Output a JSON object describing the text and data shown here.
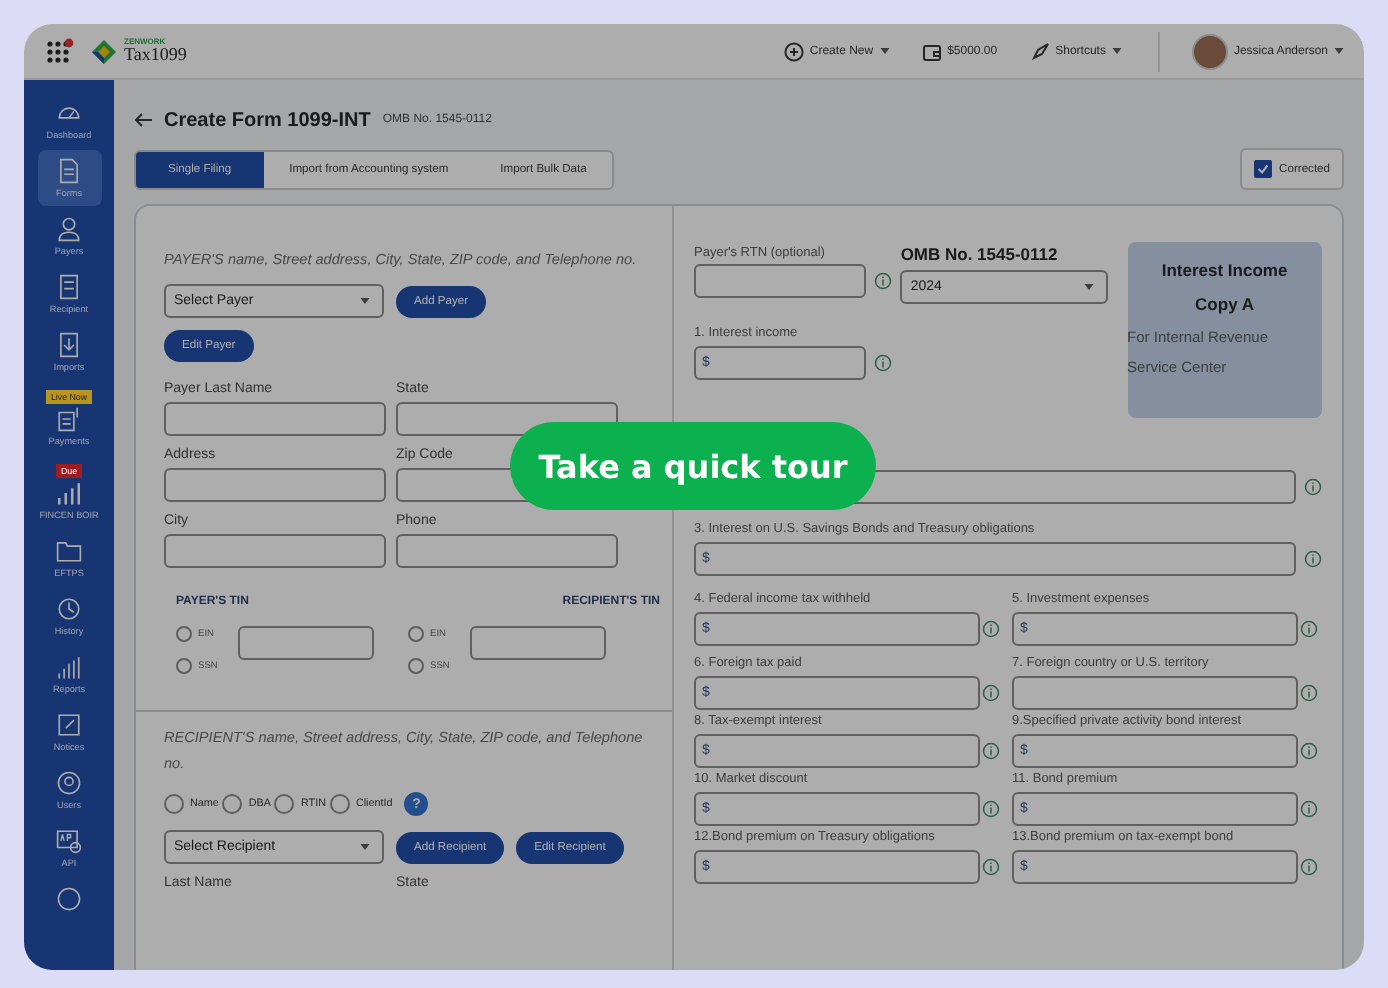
{
  "header": {
    "logo": {
      "brand": "ZENWORK",
      "product": "Tax1099"
    },
    "actions": [
      {
        "kind": "create",
        "label": "Create New",
        "dropdown": true
      },
      {
        "kind": "wallet",
        "label": "$5000.00",
        "dropdown": false
      },
      {
        "kind": "shortcuts",
        "label": "Shortcuts",
        "dropdown": true
      }
    ],
    "user": {
      "name": "Jessica Anderson"
    }
  },
  "sidebar": {
    "items": [
      {
        "kind": "dashboard",
        "label": "Dashboard",
        "selected": false
      },
      {
        "kind": "forms",
        "label": "Forms",
        "selected": true
      },
      {
        "kind": "payers",
        "label": "Payers",
        "selected": false
      },
      {
        "kind": "recipient",
        "label": "Recipient",
        "selected": false
      },
      {
        "kind": "imports",
        "label": "Imports",
        "selected": false
      },
      {
        "kind": "payments",
        "label": "Payments",
        "selected": false,
        "badge": {
          "text": "Live Now",
          "color": "#b8951e"
        }
      },
      {
        "kind": "fincen",
        "label": "FINCEN BOIR",
        "selected": false,
        "badge": {
          "text": "Due",
          "color": "#a01c22"
        }
      },
      {
        "kind": "eftps",
        "label": "EFTPS",
        "selected": false
      },
      {
        "kind": "history",
        "label": "History",
        "selected": false
      },
      {
        "kind": "reports",
        "label": "Reports",
        "selected": false
      },
      {
        "kind": "notices",
        "label": "Notices",
        "selected": false
      },
      {
        "kind": "users",
        "label": "Users",
        "selected": false
      },
      {
        "kind": "api",
        "label": "API",
        "selected": false
      },
      {
        "kind": "help"
      }
    ]
  },
  "page": {
    "title": "Create Form 1099-INT",
    "omb": "OMB No. 1545-0112",
    "tabs": [
      {
        "label": "Single Filing",
        "selected": true
      },
      {
        "label": "Import from Accounting system",
        "selected": false
      },
      {
        "label": "Import Bulk Data",
        "selected": false
      }
    ],
    "corrected": {
      "label": "Corrected",
      "checked": true
    }
  },
  "payer": {
    "note": "PAYER'S name, Street address, City, State, ZIP code, and Telephone no.",
    "select": "Select Payer",
    "add_button": "Add Payer",
    "edit_button": "Edit Payer",
    "fields": [
      "Payer Last Name",
      "State",
      "Address",
      "Zip Code",
      "City",
      "Phone"
    ],
    "tins": [
      {
        "label": "PAYER'S TIN",
        "options": [
          {
            "label": "EIN",
            "selected": false
          },
          {
            "label": "SSN",
            "selected": false
          }
        ]
      },
      {
        "label": "RECIPIENT'S TIN",
        "options": [
          {
            "label": "EIN",
            "selected": false
          },
          {
            "label": "SSN",
            "selected": false
          }
        ]
      }
    ]
  },
  "recipient": {
    "note": "RECIPIENT'S name, Street address, City, State, ZIP code, and Telephone no.",
    "options": [
      {
        "label": "Name",
        "selected": false
      },
      {
        "label": "DBA",
        "selected": false
      },
      {
        "label": "RTIN",
        "selected": false
      },
      {
        "label": "ClientId",
        "selected": false
      }
    ],
    "help": "?",
    "select": "Select Recipient",
    "add_button": "Add Recipient",
    "edit_button": "Edit Recipient",
    "fields": [
      "Last Name",
      "State"
    ]
  },
  "amounts": {
    "rtn_label": "Payer's RTN (optional)",
    "omb": "OMB No. 1545-0112",
    "year": "2024",
    "copy": {
      "title": "Interest Income",
      "copy": "Copy A",
      "subtitle": "For Internal Revenue Service Center"
    },
    "box1": {
      "label": "1. Interest income",
      "prefix": "$"
    },
    "wide": [
      {
        "label": "3. Interest on U.S. Savings Bonds and Treasury obligations",
        "prefix": "$"
      }
    ],
    "pairs": [
      {
        "label": "4. Federal income tax withheld",
        "prefix": "$"
      },
      {
        "label": "5. Investment expenses",
        "prefix": "$"
      },
      {
        "label": "6. Foreign tax paid",
        "prefix": "$"
      },
      {
        "label": "7. Foreign country or U.S. territory"
      },
      {
        "label": "8. Tax-exempt interest",
        "prefix": "$"
      },
      {
        "label": "9.Specified private activity bond interest",
        "prefix": "$"
      },
      {
        "label": "10. Market discount",
        "prefix": "$"
      },
      {
        "label": "11. Bond premium",
        "prefix": "$"
      },
      {
        "label": "12.Bond premium on Treasury obligations",
        "prefix": "$"
      },
      {
        "label": "13.Bond premium on tax-exempt bond",
        "prefix": "$"
      }
    ]
  },
  "tour": {
    "label": "Take a quick tour"
  }
}
